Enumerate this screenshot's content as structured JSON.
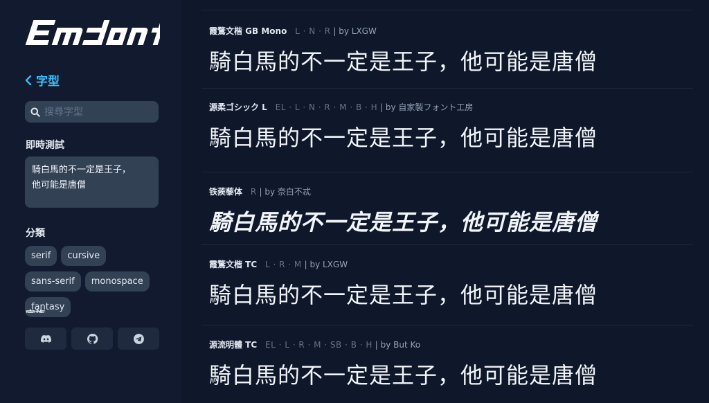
{
  "sidebar": {
    "logo_text": "Emfont",
    "back_label": "字型",
    "search_placeholder": "搜尋字型",
    "live_test_title": "即時測試",
    "live_test_text": "騎白馬的不一定是王子，\n他可能是唐僧",
    "category_title": "分類",
    "tags": [
      "serif",
      "cursive",
      "sans-serif",
      "monospace",
      "fantasy"
    ],
    "clipped_section_title": "字族",
    "social": [
      "discord-icon",
      "github-icon",
      "telegram-icon"
    ]
  },
  "fonts": [
    {
      "name": "霞鶩文楷 GB Mono",
      "weights": "L · N · R",
      "author": "| by LXGW",
      "sample": "騎白馬的不一定是王子，他可能是唐僧"
    },
    {
      "name": "源柔ゴシック L",
      "weights": "EL · L · N · R · M · B · H",
      "author": "| by 自家製フォント工房",
      "sample": "騎白馬的不一定是王子，他可能是唐僧"
    },
    {
      "name": "铁蒺藜体",
      "weights": "R",
      "author": "| by 奈白不忒",
      "sample": "騎白馬的不一定是王子，他可能是唐僧"
    },
    {
      "name": "霞鶩文楷 TC",
      "weights": "L · R · M",
      "author": "| by LXGW",
      "sample": "騎白馬的不一定是王子，他可能是唐僧"
    },
    {
      "name": "源流明體 TC",
      "weights": "EL · L · R · M · SB · B · H",
      "author": "| by But Ko",
      "sample": "騎白馬的不一定是王子，他可能是唐僧"
    }
  ],
  "colors": {
    "background": "#0f172a",
    "sidebar": "#111a2e",
    "accent": "#38bdf8",
    "input": "#334155"
  }
}
